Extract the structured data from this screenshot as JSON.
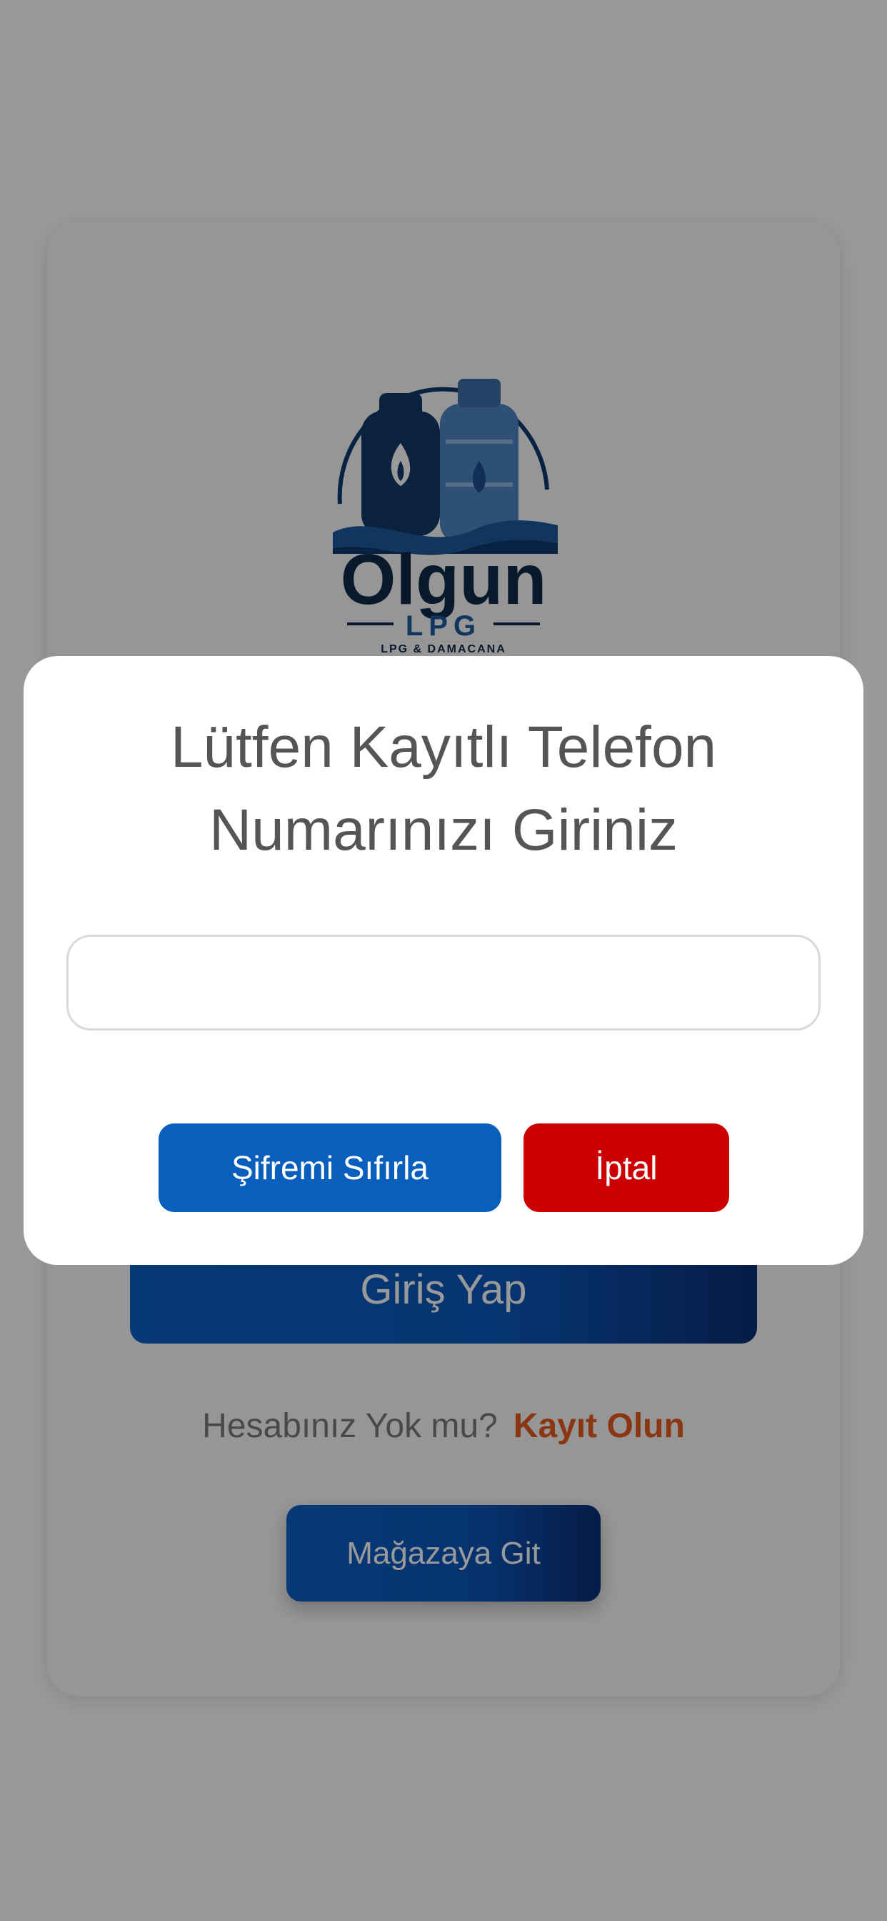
{
  "login": {
    "login_button": "Giriş Yap",
    "register_prompt": "Hesabınız Yok mu?",
    "register_link": "Kayıt Olun",
    "store_button": "Mağazaya Git"
  },
  "logo": {
    "brand_name": "Olgun",
    "brand_sub": "LPG",
    "brand_tagline": "LPG & DAMACANA"
  },
  "dialog": {
    "title_line1": "Lütfen Kayıtlı Telefon",
    "title_line2": "Numarınızı Giriniz",
    "phone_value": "",
    "phone_placeholder": "",
    "reset_button": "Şifremi Sıfırla",
    "cancel_button": "İptal"
  },
  "colors": {
    "primary_blue": "#0a5fbd",
    "dark_blue": "#0a2f76",
    "cancel_red": "#cc0000",
    "link_orange": "#e65a1f"
  }
}
